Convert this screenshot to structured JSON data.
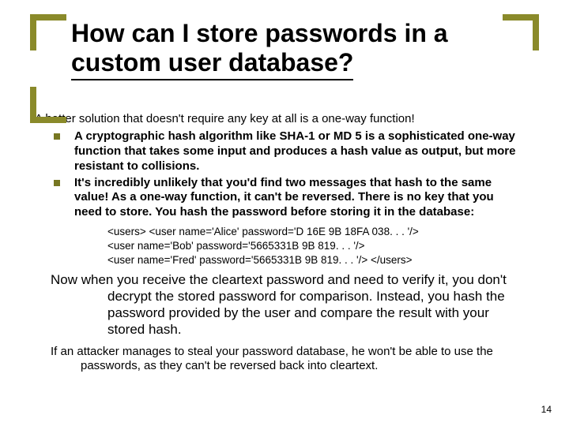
{
  "title_line1": "How can I store passwords in a",
  "title_line2": "custom user database?",
  "intro": "A better solution that doesn't require any key at all is a one-way function!",
  "bullets": [
    "A cryptographic hash algorithm like SHA-1 or MD 5 is a sophisticated one-way function that takes some input and produces a hash value as output, but more resistant to collisions.",
    "It's incredibly unlikely that you'd find two messages that hash to the same value! As a one-way function, it can't be reversed. There is no key that you need to store. You hash the password before storing it in the database:"
  ],
  "code": [
    "<users> <user name='Alice' password='D 16E 9B 18FA 038. . . '/>",
    "<user name='Bob' password='5665331B 9B 819. . . '/>",
    "<user name='Fred' password='5665331B 9B 819. . . '/> </users>"
  ],
  "para_now": "Now when you receive the cleartext password and need to verify it, you don't decrypt the stored password for comparison. Instead, you hash the password provided by the user and compare the result with your stored hash.",
  "para_attacker": "If an attacker manages to steal your password database, he won't be able to use the passwords, as they can't be reversed back into cleartext.",
  "page_number": "14"
}
